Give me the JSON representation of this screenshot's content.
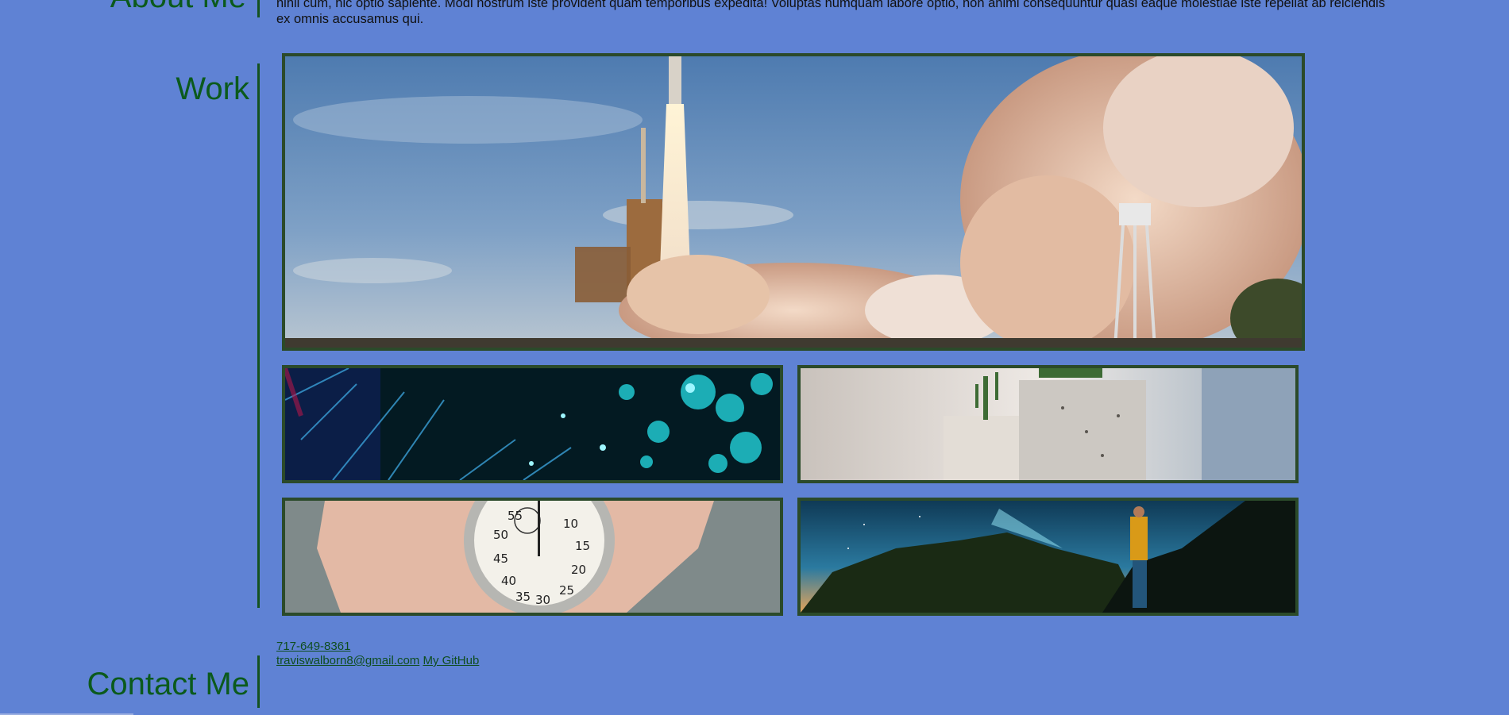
{
  "about": {
    "heading": "About Me",
    "text": "nihil cum, hic optio sapiente. Modi nostrum iste provident quam temporibus expedita! Voluptas numquam labore optio, non animi consequuntur quasi eaque molestiae iste repellat ab reiciendis ex omnis accusamus qui."
  },
  "work": {
    "heading": "Work"
  },
  "contact": {
    "heading": "Contact Me",
    "phone": "717-649-8361",
    "email": "traviswalborn8@gmail.com",
    "github": "My GitHub"
  },
  "colors": {
    "background": "#5f82d4",
    "heading": "#0b5a1c",
    "divider": "#14521f",
    "image_border": "#2b4a2a",
    "link": "#0e4d1f"
  }
}
